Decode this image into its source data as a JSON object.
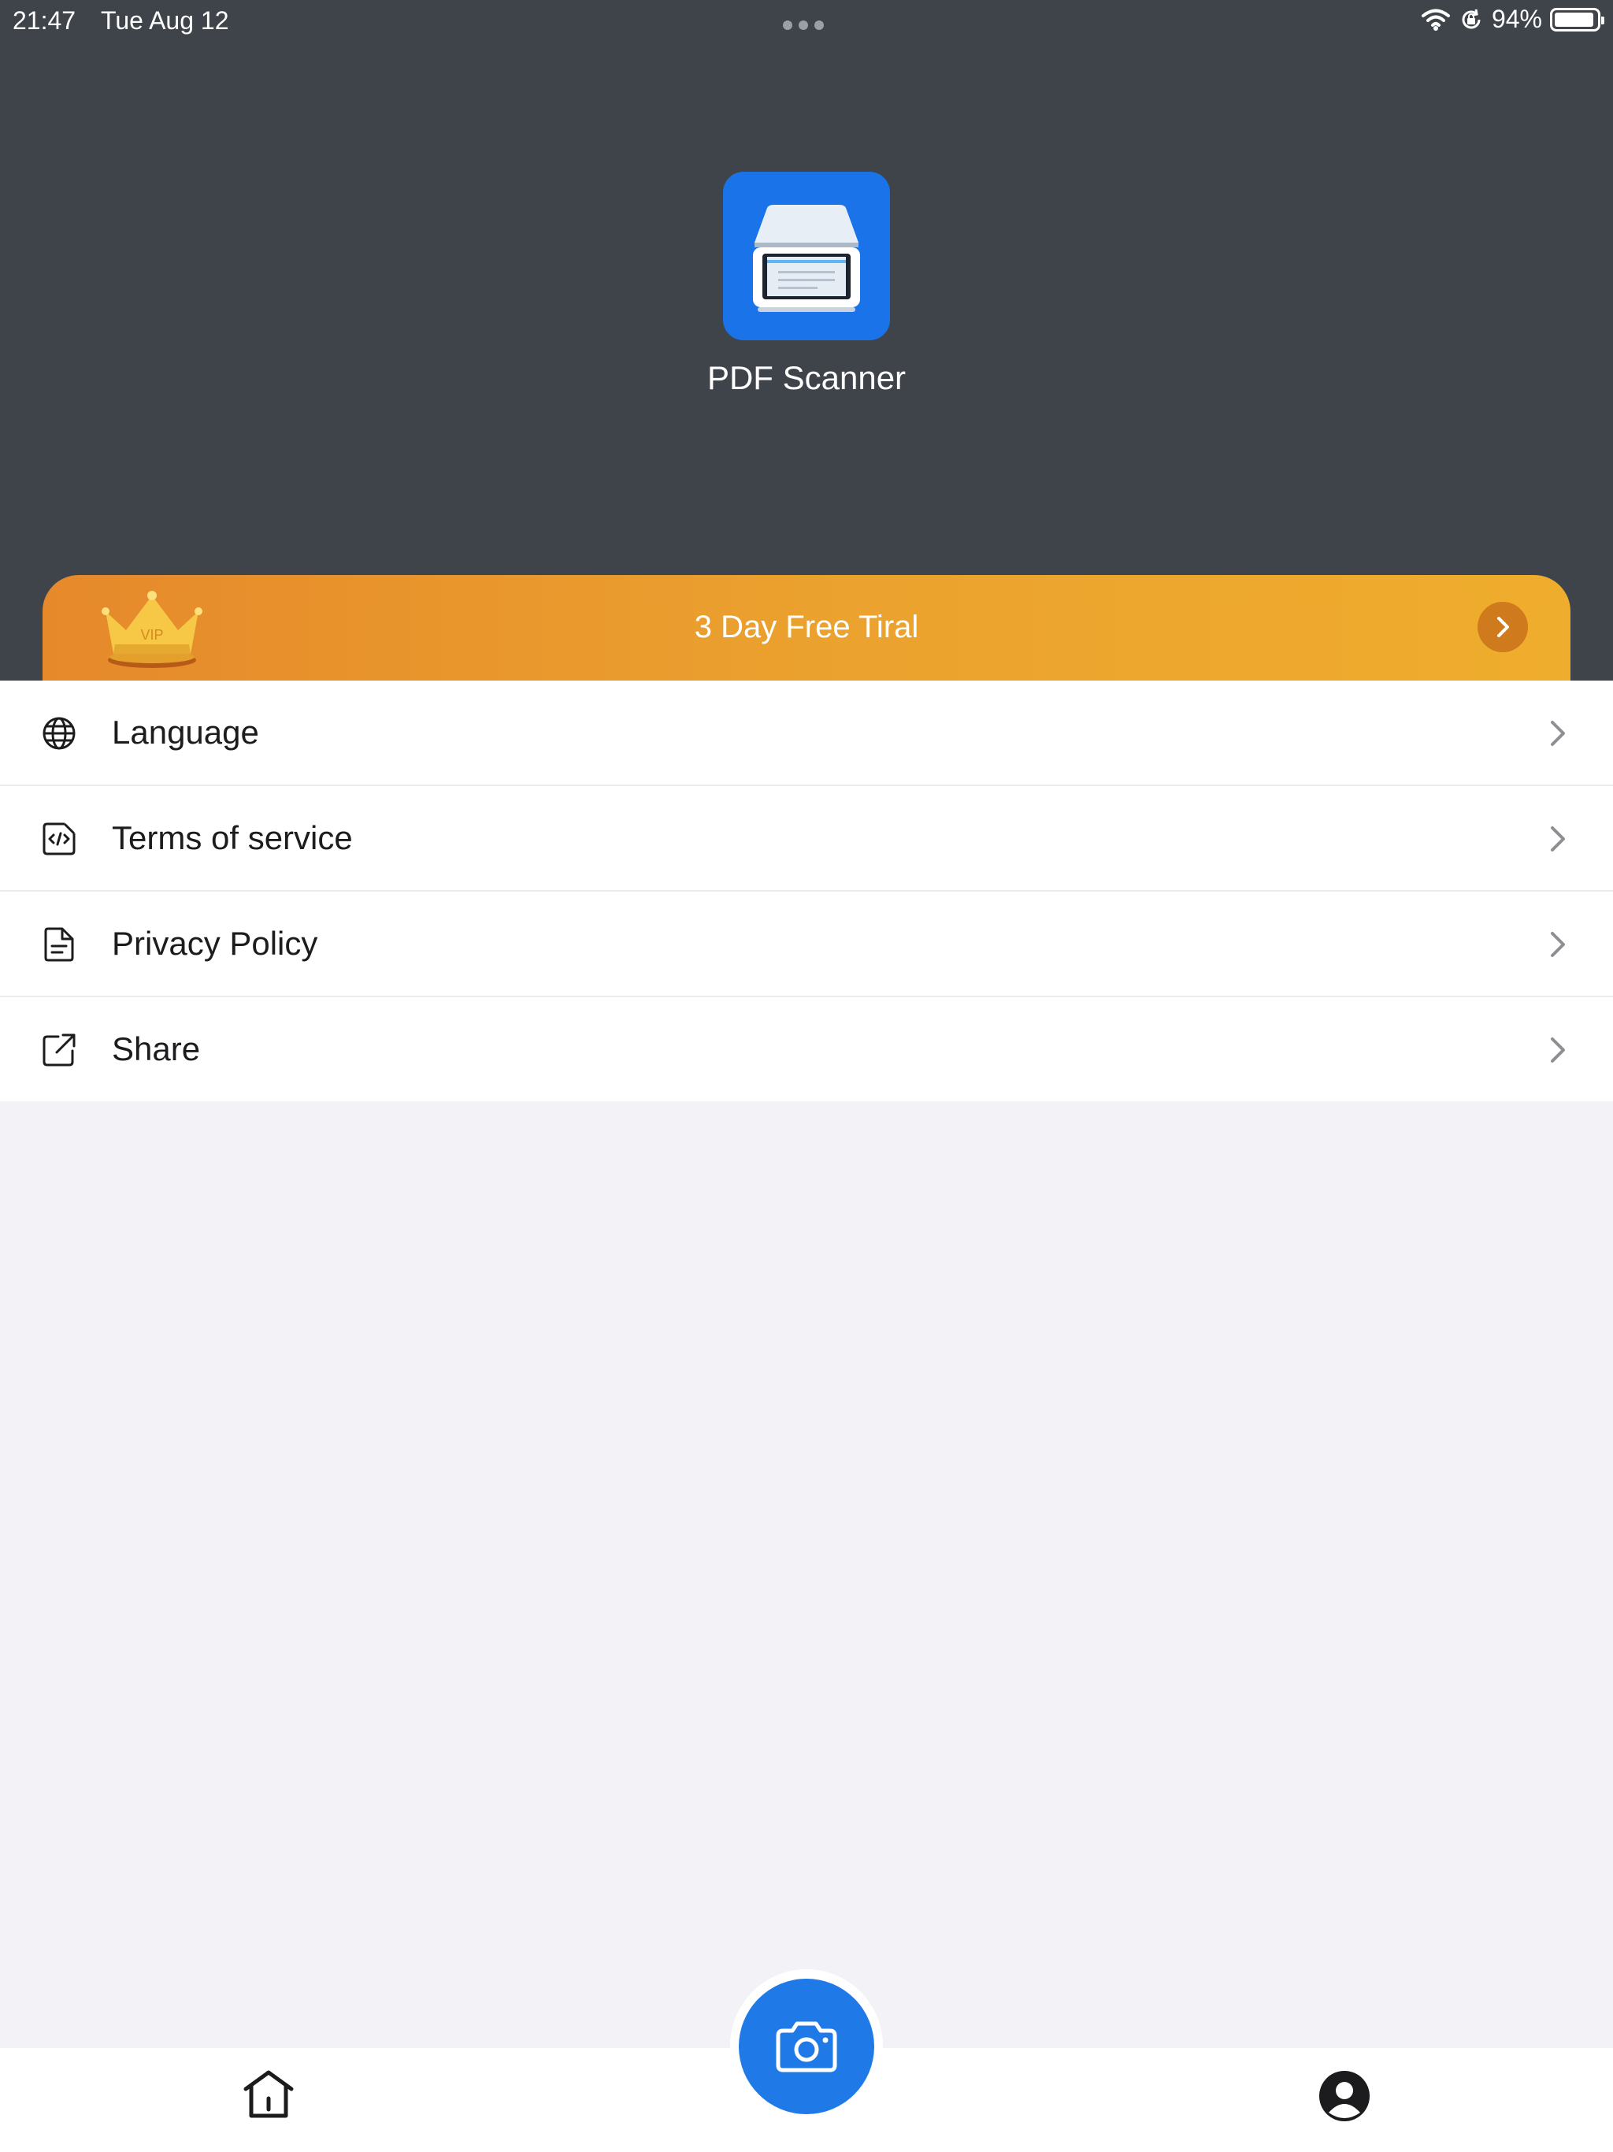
{
  "status_bar": {
    "time": "21:47",
    "date": "Tue Aug 12",
    "battery": "94%",
    "battery_level": 0.94
  },
  "app": {
    "name": "PDF Scanner",
    "icon": "scanner-app-icon",
    "icon_color": "#1a73e8"
  },
  "vip_banner": {
    "badge": "VIP",
    "text": "3 Day Free Tiral",
    "icon": "crown-icon",
    "gradient_start": "#e6892b",
    "gradient_end": "#efad2d"
  },
  "menu": {
    "items": [
      {
        "label": "Language",
        "icon": "globe-icon"
      },
      {
        "label": "Terms of service",
        "icon": "code-document-icon"
      },
      {
        "label": "Privacy Policy",
        "icon": "document-icon"
      },
      {
        "label": "Share",
        "icon": "share-icon"
      }
    ]
  },
  "tab_bar": {
    "items": [
      {
        "icon": "home-icon"
      },
      {
        "icon": "camera-icon",
        "color": "#1f7ae8"
      },
      {
        "icon": "profile-icon"
      }
    ]
  },
  "colors": {
    "header_bg": "#3f444b",
    "page_bg": "#f2f2f7",
    "accent": "#1f7ae8"
  }
}
